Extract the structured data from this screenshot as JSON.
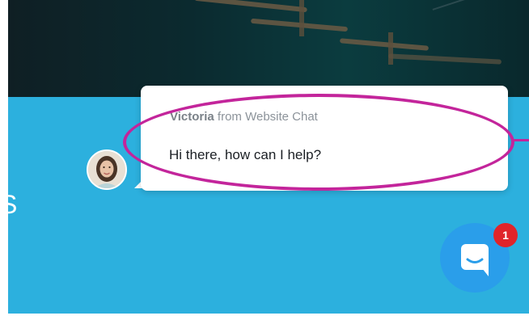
{
  "chat_popup": {
    "sender_name": "Victoria",
    "sender_suffix": " from Website Chat",
    "message": "Hi there, how can I help?"
  },
  "page": {
    "partial_heading": "S"
  },
  "launcher": {
    "icon": "chat-bubble-icon",
    "unread_count": "1"
  },
  "colors": {
    "panel_blue": "#2cb0de",
    "launcher_blue": "#2a9eea",
    "badge_red": "#e0242a",
    "annotation_magenta": "#c3259b"
  }
}
